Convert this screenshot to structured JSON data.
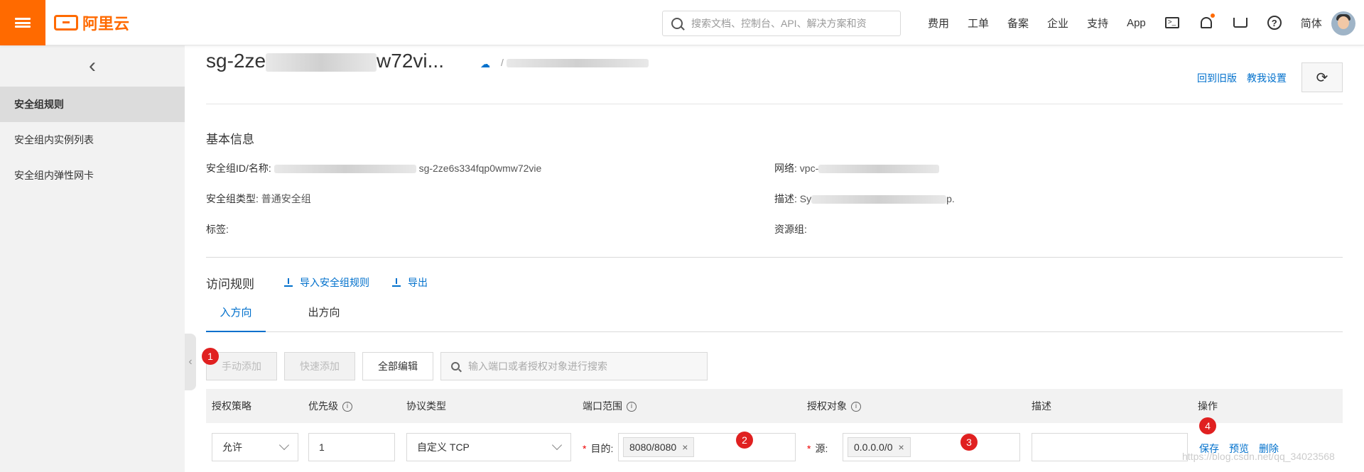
{
  "topbar": {
    "logo_text": "阿里云",
    "search_placeholder": "搜索文档、控制台、API、解决方案和资",
    "nav_items": [
      "费用",
      "工单",
      "备案",
      "企业",
      "支持",
      "App"
    ],
    "language": "简体",
    "icons": [
      "terminal-icon",
      "bell-icon",
      "cart-icon",
      "help-icon"
    ],
    "accent_color": "#ff6a00"
  },
  "sidebar": {
    "items": [
      "安全组规则",
      "安全组内实例列表",
      "安全组内弹性网卡"
    ],
    "active_index": 0
  },
  "header": {
    "title_prefix": "sg-2ze",
    "title_suffix": "w72vi...",
    "subtitle": "/",
    "back_link": "回到旧版",
    "help_link": "教我设置"
  },
  "basic_info": {
    "title": "基本信息",
    "sg_id_label": "安全组ID/名称:",
    "sg_id_value": "sg-2ze6s334fqp0wmw72vie",
    "sg_type_label": "安全组类型:",
    "sg_type_value": "普通安全组",
    "tags_label": "标签:",
    "network_label": "网络:",
    "network_value": "vpc-",
    "desc_label": "描述:",
    "desc_value": "Sy",
    "desc_tail": "p.",
    "resource_group_label": "资源组:"
  },
  "rules": {
    "title": "访问规则",
    "import_link": "导入安全组规则",
    "export_link": "导出",
    "tabs": [
      "入方向",
      "出方向"
    ],
    "active_tab": 0,
    "buttons": {
      "manual_add": "手动添加",
      "quick_add": "快速添加",
      "edit_all": "全部编辑"
    },
    "search_placeholder": "输入端口或者授权对象进行搜索",
    "columns": [
      "授权策略",
      "优先级",
      "协议类型",
      "端口范围",
      "授权对象",
      "描述",
      "操作"
    ],
    "row": {
      "policy": "允许",
      "priority": "1",
      "protocol": "自定义 TCP",
      "port_label": "目的:",
      "port_value": "8080/8080",
      "source_label": "源:",
      "source_value": "0.0.0.0/0",
      "description": "",
      "ops": [
        "保存",
        "预览",
        "删除"
      ]
    },
    "badges": [
      "1",
      "2",
      "3",
      "4"
    ],
    "badge_color": "#e02020",
    "link_color": "#0070cc"
  },
  "watermark": "https://blog.csdn.net/qq_34023568"
}
